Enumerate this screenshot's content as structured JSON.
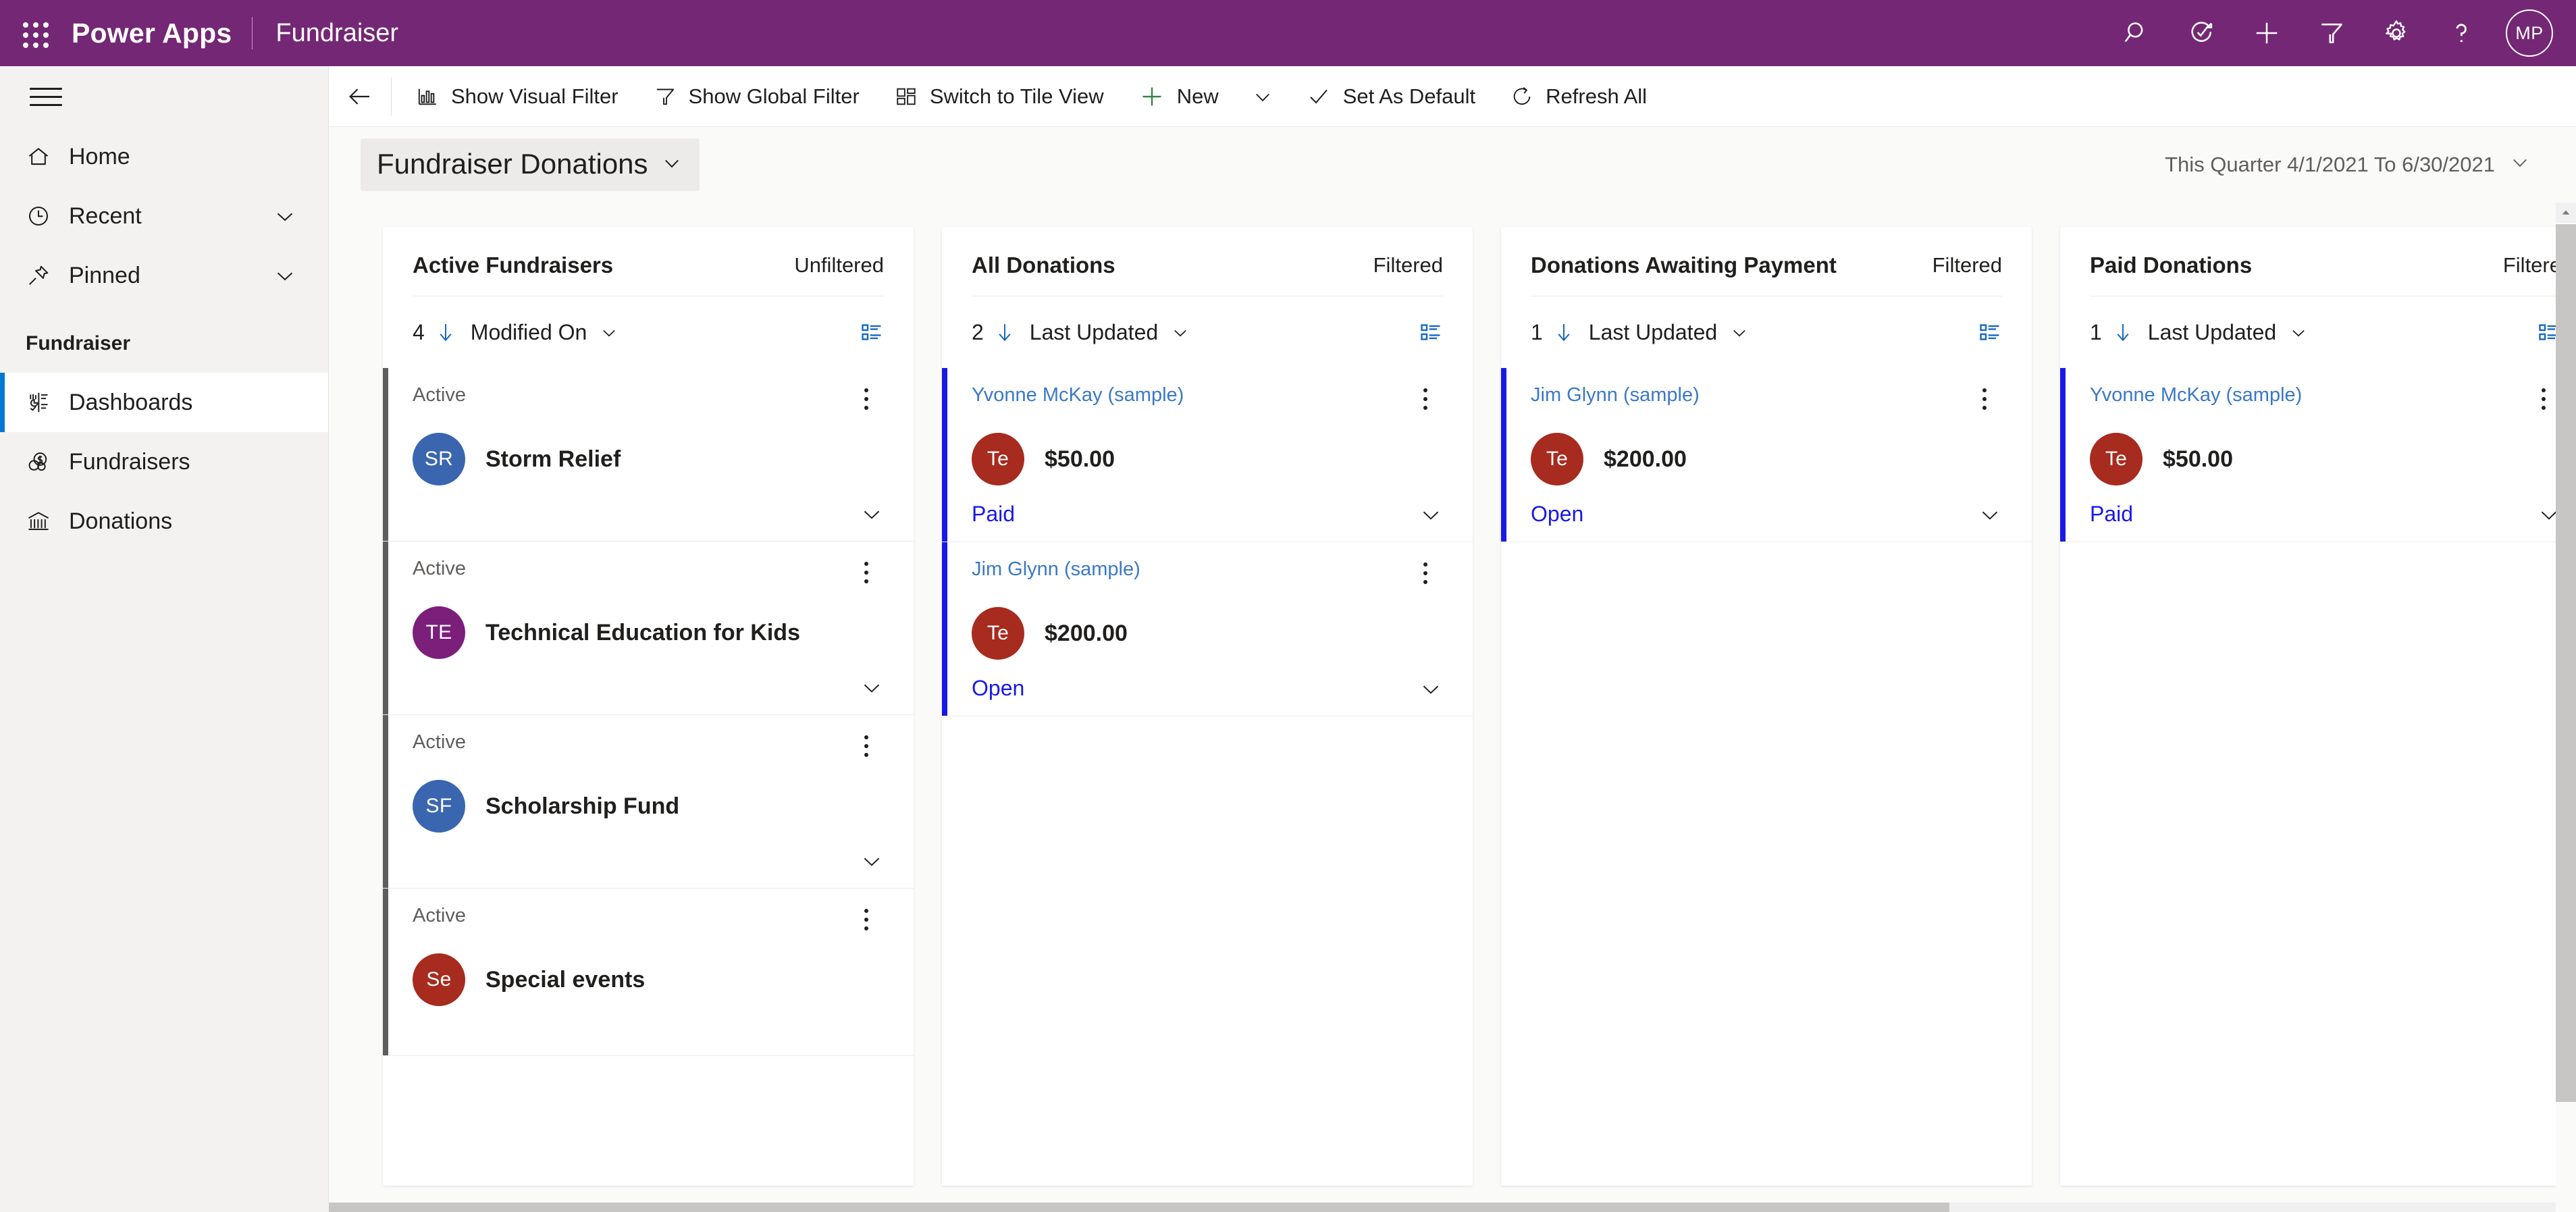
{
  "topbar": {
    "waffle_label": "waffle",
    "brand": "Power Apps",
    "app_name": "Fundraiser",
    "icons": [
      {
        "name": "search-icon",
        "label": "Search"
      },
      {
        "name": "assistant-icon",
        "label": "Assistant"
      },
      {
        "name": "plus-icon",
        "label": "New"
      },
      {
        "name": "filter-icon",
        "label": "Filter"
      },
      {
        "name": "gear-icon",
        "label": "Settings"
      },
      {
        "name": "help-icon",
        "label": "Help"
      }
    ],
    "avatar_initials": "MP",
    "background_color": "#742774"
  },
  "sidebar": {
    "hamburger_label": "Site map",
    "items": [
      {
        "label": "Home",
        "icon": "home-icon",
        "expandable": false,
        "selected": false
      },
      {
        "label": "Recent",
        "icon": "clock-icon",
        "expandable": true,
        "selected": false
      },
      {
        "label": "Pinned",
        "icon": "pin-icon",
        "expandable": true,
        "selected": false
      }
    ],
    "group_title": "Fundraiser",
    "group_items": [
      {
        "label": "Dashboards",
        "icon": "dashboard-icon",
        "selected": true
      },
      {
        "label": "Fundraisers",
        "icon": "coins-icon",
        "selected": false
      },
      {
        "label": "Donations",
        "icon": "bank-icon",
        "selected": false
      }
    ],
    "selection_color": "#0078d4"
  },
  "commandbar": {
    "back_label": "Back",
    "commands": [
      {
        "label": "Show Visual Filter",
        "icon": "bar-chart-icon",
        "has_caret": false
      },
      {
        "label": "Show Global Filter",
        "icon": "funnel-icon",
        "has_caret": false
      },
      {
        "label": "Switch to Tile View",
        "icon": "tiles-icon",
        "has_caret": false
      },
      {
        "label": "New",
        "icon": "plus-icon",
        "has_caret": true
      },
      {
        "label": "Set As Default",
        "icon": "check-icon",
        "has_caret": false
      },
      {
        "label": "Refresh All",
        "icon": "refresh-icon",
        "has_caret": false
      }
    ],
    "new_icon_color": "#2e8540"
  },
  "dashboard": {
    "title": "Fundraiser Donations",
    "title_caret": "chevron-down-icon",
    "date_range": "This Quarter 4/1/2021 To 6/30/2021",
    "date_range_caret": "chevron-down-icon"
  },
  "columns": [
    {
      "title": "Active Fundraisers",
      "filter_state": "Unfiltered",
      "count": "4",
      "sort_field": "Modified On",
      "view_selector_icon": "list-view-icon",
      "bar_color": "#605e5c",
      "cards": [
        {
          "subtitle": "Active",
          "subtitle_is_link": false,
          "pill_text": "SR",
          "pill_color": "#3a66b0",
          "main": "Storm Relief",
          "main_bold": true,
          "status": "",
          "has_chevron": true
        },
        {
          "subtitle": "Active",
          "subtitle_is_link": false,
          "pill_text": "TE",
          "pill_color": "#7b1f7b",
          "main": "Technical Education for Kids",
          "main_bold": true,
          "status": "",
          "has_chevron": true
        },
        {
          "subtitle": "Active",
          "subtitle_is_link": false,
          "pill_text": "SF",
          "pill_color": "#3a66b0",
          "main": "Scholarship Fund",
          "main_bold": true,
          "status": "",
          "has_chevron": true
        },
        {
          "subtitle": "Active",
          "subtitle_is_link": false,
          "pill_text": "Se",
          "pill_color": "#a72b1e",
          "main": "Special events",
          "main_bold": true,
          "status": "",
          "has_chevron": false
        }
      ]
    },
    {
      "title": "All Donations",
      "filter_state": "Filtered",
      "count": "2",
      "sort_field": "Last Updated",
      "view_selector_icon": "list-view-icon",
      "bar_color": "#1919e6",
      "cards": [
        {
          "subtitle": "Yvonne McKay (sample)",
          "subtitle_is_link": true,
          "pill_text": "Te",
          "pill_color": "#a72b1e",
          "main": "$50.00",
          "main_bold": true,
          "status": "Paid",
          "has_chevron": true
        },
        {
          "subtitle": "Jim Glynn (sample)",
          "subtitle_is_link": true,
          "pill_text": "Te",
          "pill_color": "#a72b1e",
          "main": "$200.00",
          "main_bold": true,
          "status": "Open",
          "has_chevron": true
        }
      ]
    },
    {
      "title": "Donations Awaiting Payment",
      "filter_state": "Filtered",
      "count": "1",
      "sort_field": "Last Updated",
      "view_selector_icon": "list-view-icon",
      "bar_color": "#1919e6",
      "cards": [
        {
          "subtitle": "Jim Glynn (sample)",
          "subtitle_is_link": true,
          "pill_text": "Te",
          "pill_color": "#a72b1e",
          "main": "$200.00",
          "main_bold": true,
          "status": "Open",
          "has_chevron": true
        }
      ]
    },
    {
      "title": "Paid Donations",
      "filter_state": "Filtere",
      "count": "1",
      "sort_field": "Last Updated",
      "view_selector_icon": "list-view-icon",
      "bar_color": "#1919e6",
      "cards": [
        {
          "subtitle": "Yvonne McKay (sample)",
          "subtitle_is_link": true,
          "pill_text": "Te",
          "pill_color": "#a72b1e",
          "main": "$50.00",
          "main_bold": true,
          "status": "Paid",
          "has_chevron": true
        }
      ]
    }
  ],
  "scrollbars": {
    "vertical_label": "vertical-scrollbar",
    "horizontal_label": "horizontal-scrollbar"
  }
}
